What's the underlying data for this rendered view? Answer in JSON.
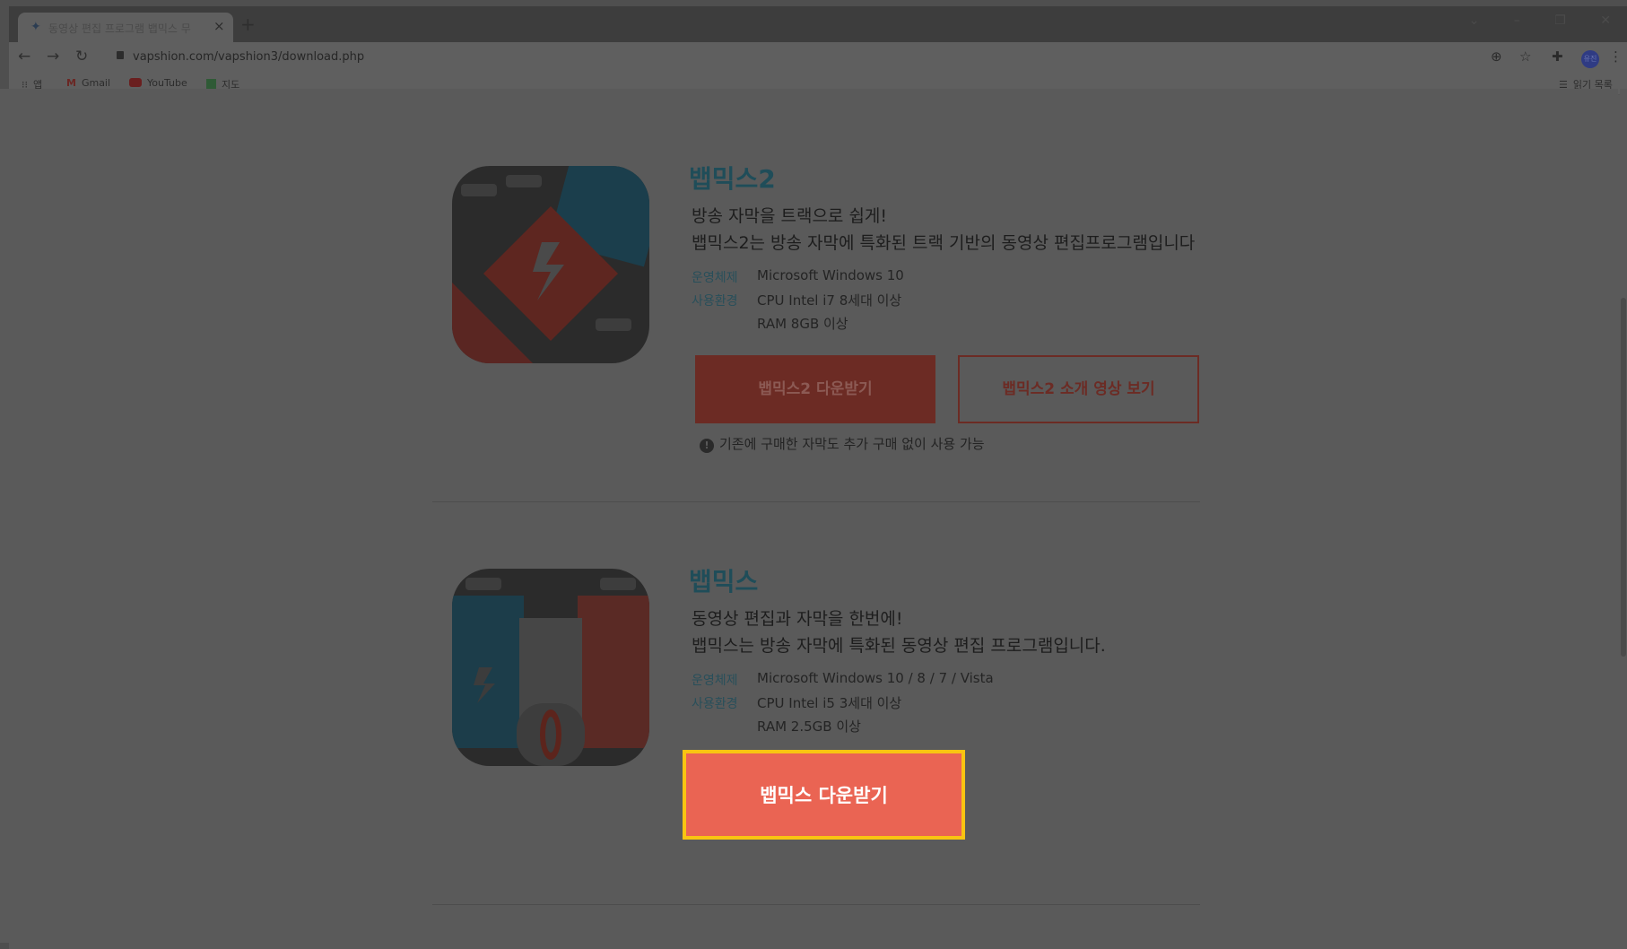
{
  "browser": {
    "tab_title": "동영상 편집 프로그램 뱁믹스 무",
    "tab_close": "×",
    "new_tab": "+",
    "url": "vapshion.com/vapshion3/download.php",
    "avatar_text": "유진",
    "bookmarks": [
      {
        "label": "앱",
        "icon": "apps-grid-icon"
      },
      {
        "label": "Gmail",
        "icon": "gmail-icon"
      },
      {
        "label": "YouTube",
        "icon": "youtube-icon"
      },
      {
        "label": "지도",
        "icon": "maps-icon"
      }
    ],
    "reading_list": "읽기 목록"
  },
  "products": [
    {
      "title": "뱁믹스2",
      "tagline1": "방송 자막을 트랙으로 쉽게!",
      "tagline2": "뱁믹스2는 방송 자막에 특화된 트랙 기반의 동영상 편집프로그램입니다",
      "os_label": "운영체제",
      "os_value": "Microsoft Windows 10",
      "env_label": "사용환경",
      "env_cpu": "CPU Intel i7 8세대 이상",
      "env_ram": "RAM 8GB 이상",
      "download_label": "뱁믹스2 다운받기",
      "intro_label": "뱁믹스2 소개 영상 보기",
      "note": "기존에 구매한 자막도 추가 구매 없이 사용 가능"
    },
    {
      "title": "뱁믹스",
      "tagline1": "동영상 편집과 자막을 한번에!",
      "tagline2": "뱁믹스는 방송 자막에 특화된 동영상 편집 프로그램입니다.",
      "os_label": "운영체제",
      "os_value": "Microsoft Windows 10 / 8 / 7 / Vista",
      "env_label": "사용환경",
      "env_cpu": "CPU Intel i5 3세대 이상",
      "env_ram": "RAM 2.5GB 이상",
      "download_label": "뱁믹스 다운받기"
    }
  ],
  "colors": {
    "highlight_border": "#f9c412",
    "download_button": "#ea6453",
    "title_teal": "#1f4d59"
  }
}
